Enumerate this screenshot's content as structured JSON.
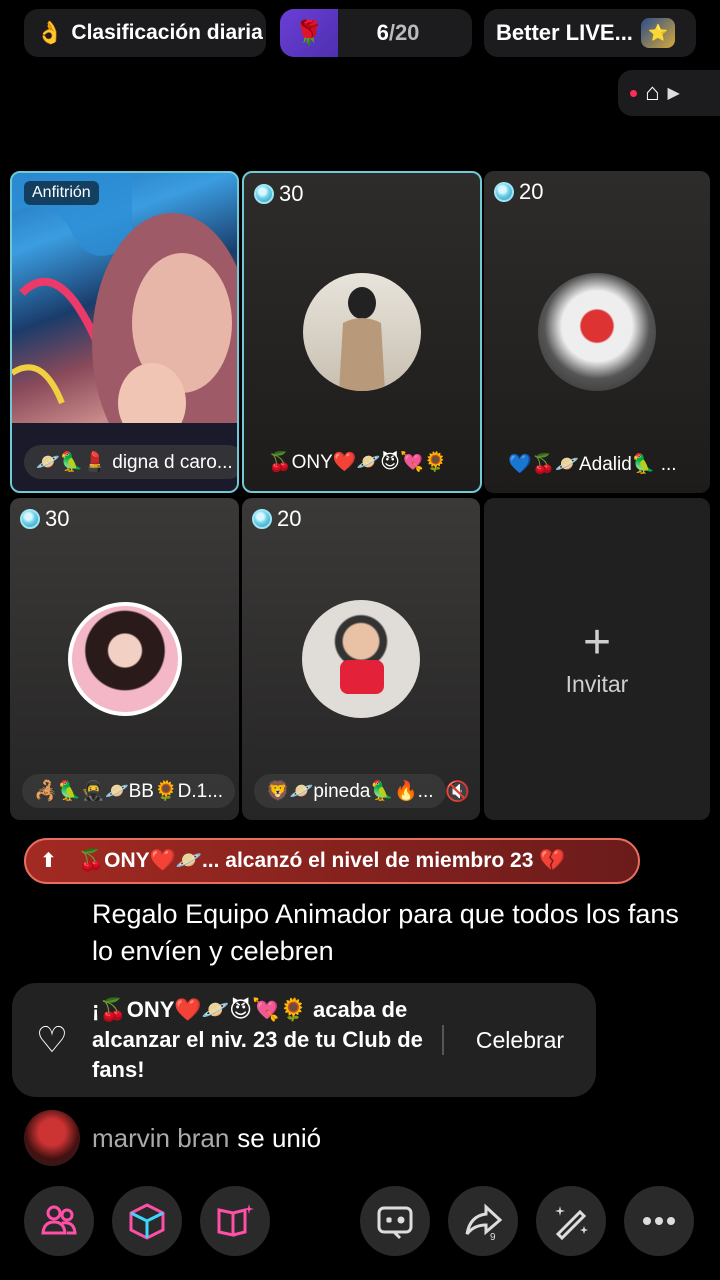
{
  "top": {
    "daily_label": "Clasificación diaria",
    "progress_current": "6",
    "progress_total": "/20",
    "live_title": "Better LIVE..."
  },
  "grid": {
    "host_tag": "Anfitrión",
    "tiles": [
      {
        "score": "",
        "name": "🪐🦜💄 digna d caro..."
      },
      {
        "score": "30",
        "name": "🍒ONY❤️🪐😈💘🌻"
      },
      {
        "score": "20",
        "name": "💙🍒🪐Adalid🦜 ..."
      },
      {
        "score": "30",
        "name": "🦂🦜🥷🪐BB🌻D.1..."
      },
      {
        "score": "20",
        "name": "🦁🪐pineda🦜🔥..."
      }
    ],
    "invite_label": "Invitar"
  },
  "feed": {
    "member_banner": "🍒ONY❤️🪐... alcanzó el nivel de miembro 23 💔",
    "gift_message": "Regalo Equipo Animador para que todos los fans lo envíen y celebren",
    "fanclub_text": "¡🍒ONY❤️🪐😈💘🌻 acaba de alcanzar el niv. 23 de tu Club de fans!",
    "celebrate_label": "Celebrar",
    "joined_user": "marvin bran",
    "joined_text": "se unió"
  },
  "icons": {
    "toolbar": [
      "people-icon",
      "cube-icon",
      "book-sparkle-icon",
      "game-icon",
      "share-icon",
      "magic-wand-icon",
      "more-icon"
    ]
  },
  "colors": {
    "selected_border": "#6fc9d6",
    "member_banner": "#a22a22",
    "toolbar_pink": "#ff4fa8"
  }
}
